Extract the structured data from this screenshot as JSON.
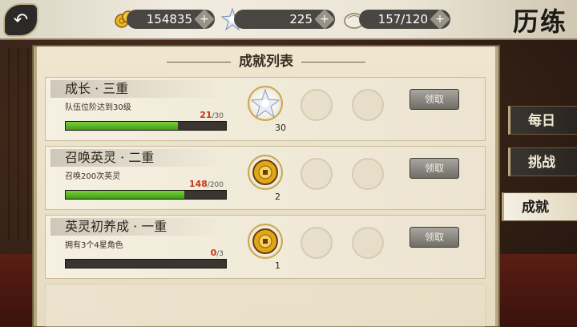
{
  "header": {
    "title": "历练",
    "gold": "154835",
    "crystal": "225",
    "stamina": "157/120",
    "add_symbol": "+"
  },
  "panel": {
    "title": "成就列表",
    "claim_label": "领取",
    "cards": [
      {
        "name": "成长 · 三重",
        "desc": "队伍位阶达到30级",
        "progress": "21",
        "total": "/30",
        "fraction": 0.7,
        "reward_icon": "crystal-icon",
        "reward_count": "30"
      },
      {
        "name": "召唤英灵 · 二重",
        "desc": "召唤200次英灵",
        "progress": "148",
        "total": "/200",
        "fraction": 0.74,
        "reward_icon": "gold-coin-icon",
        "reward_count": "2"
      },
      {
        "name": "英灵初养成 · 一重",
        "desc": "拥有3个4星角色",
        "progress": "0",
        "total": "/3",
        "fraction": 0,
        "reward_icon": "gold-coin-icon",
        "reward_count": "1"
      }
    ]
  },
  "tabs": [
    {
      "label": "每日",
      "active": false
    },
    {
      "label": "挑战",
      "active": false
    },
    {
      "label": "成就",
      "active": true
    }
  ]
}
